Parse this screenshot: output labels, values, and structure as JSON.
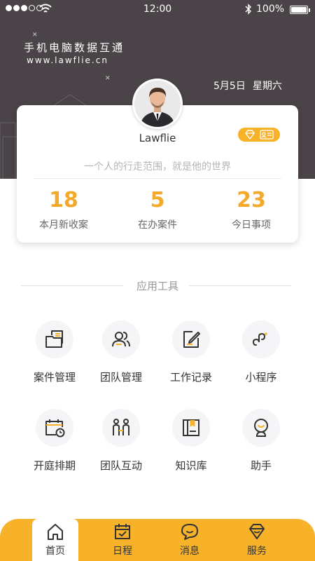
{
  "status_bar": {
    "time": "12:00",
    "battery": "100%",
    "signal_icon": "signal-dots-icon",
    "wifi_icon": "wifi-icon",
    "bluetooth_icon": "bluetooth-icon"
  },
  "brand": {
    "title": "手机电脑数据互通",
    "url": "www.lawflie.cn"
  },
  "date": {
    "day": "5月5日",
    "weekday": "星期六"
  },
  "profile": {
    "username": "Lawflie",
    "motto": "一个人的行走范围，就是他的世界",
    "badge_icons": [
      "diamond-icon",
      "id-card-icon"
    ]
  },
  "stats": [
    {
      "value": "18",
      "label": "本月新收案"
    },
    {
      "value": "5",
      "label": "在办案件"
    },
    {
      "value": "23",
      "label": "今日事项"
    }
  ],
  "tools_section": {
    "title": "应用工具",
    "items": [
      {
        "label": "案件管理",
        "icon": "folder-files-icon"
      },
      {
        "label": "团队管理",
        "icon": "team-icon"
      },
      {
        "label": "工作记录",
        "icon": "edit-note-icon"
      },
      {
        "label": "小程序",
        "icon": "mini-program-icon"
      },
      {
        "label": "开庭排期",
        "icon": "calendar-clock-icon"
      },
      {
        "label": "团队互动",
        "icon": "people-interact-icon"
      },
      {
        "label": "知识库",
        "icon": "book-icon"
      },
      {
        "label": "助手",
        "icon": "assistant-icon"
      }
    ]
  },
  "tabbar": {
    "items": [
      {
        "label": "首页",
        "icon": "home-icon",
        "active": true
      },
      {
        "label": "日程",
        "icon": "calendar-check-icon",
        "active": false
      },
      {
        "label": "消息",
        "icon": "message-icon",
        "active": false
      },
      {
        "label": "服务",
        "icon": "diamond-service-icon",
        "active": false
      }
    ]
  },
  "colors": {
    "accent": "#f7b22a",
    "stat_number": "#f3a92b",
    "header_bg": "#4a4448"
  }
}
